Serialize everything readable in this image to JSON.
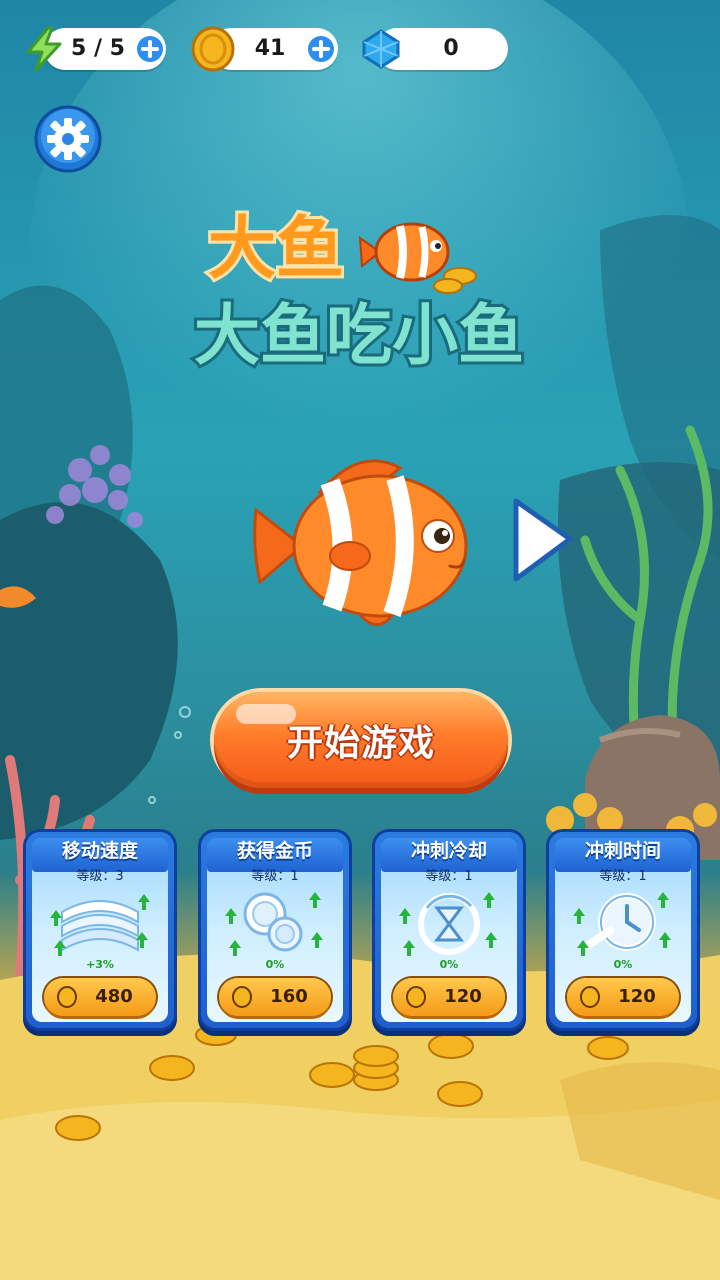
{
  "resources": {
    "energy": {
      "icon": "lightning-icon",
      "value": "5 / 5"
    },
    "coins": {
      "icon": "coin-icon",
      "value": "41"
    },
    "gems": {
      "icon": "gem-icon",
      "value": "0"
    }
  },
  "title": {
    "line1": "大鱼",
    "line2": "大鱼吃小鱼"
  },
  "start_button": {
    "label": "开始游戏"
  },
  "upgrades": [
    {
      "name": "移动速度",
      "level": "等级：3",
      "percent": "+3%",
      "cost": "480",
      "icon": "speed-waves-icon"
    },
    {
      "name": "获得金币",
      "level": "等级：1",
      "percent": "0%",
      "cost": "160",
      "icon": "coins-icon"
    },
    {
      "name": "冲刺冷却",
      "level": "等级：1",
      "percent": "0%",
      "cost": "120",
      "icon": "hourglass-icon"
    },
    {
      "name": "冲刺时间",
      "level": "等级：1",
      "percent": "0%",
      "cost": "120",
      "icon": "stopwatch-icon"
    }
  ],
  "colors": {
    "accent": "#ff7c2a",
    "card": "#1f5fcf",
    "coin": "#f5b51e",
    "gem": "#2ea9f0"
  }
}
